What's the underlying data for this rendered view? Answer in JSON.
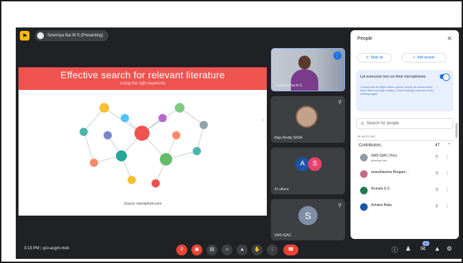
{
  "presenter": {
    "label": "Sowmiya Bai M S (Presenting)"
  },
  "slide": {
    "title": "Effective search for relevant literature",
    "subtitle": "Using the right keywords",
    "source": "Source: istockphoto.com"
  },
  "tiles": {
    "t1_name": "Sowmiya Bai M S",
    "t2_name": "Rajo Reddy SIGIA",
    "t3_initials": [
      "A",
      "S"
    ],
    "t3_name": "41 others",
    "t4_initial": "S",
    "t4_name": "SMS IQAC"
  },
  "people_panel": {
    "title": "People",
    "mute_all": "Mute all",
    "add_people": "Add people",
    "toggle_label": "Let everyone turn on their microphones",
    "toggle_help": "Turning this off might reduce people joining all microphones when they're joining meeting. These settings continue for the meeting again.",
    "search_placeholder": "Search for people",
    "section_label": "IN MEETING",
    "group_label": "Contributors",
    "group_count": "47",
    "participants": [
      {
        "name": "SMS IQAC (You)",
        "sub": "Meeting host",
        "color": "#8e9aa8"
      },
      {
        "name": "anandhasena Bhagam…",
        "sub": "",
        "color": "#c46a8a"
      },
      {
        "name": "Arunala S.S",
        "sub": "",
        "color": "#1e7d4a"
      },
      {
        "name": "Ashwini Babu",
        "sub": "",
        "color": "#1a56a8"
      }
    ]
  },
  "bottom": {
    "time": "3:19 PM",
    "meeting_code": "qro-asgm-mxk",
    "badge": "47"
  },
  "colors": {
    "slide_header": "#ef5350",
    "accent": "#1a73e8",
    "end_call": "#ea4335",
    "meet_bg": "#202124"
  }
}
